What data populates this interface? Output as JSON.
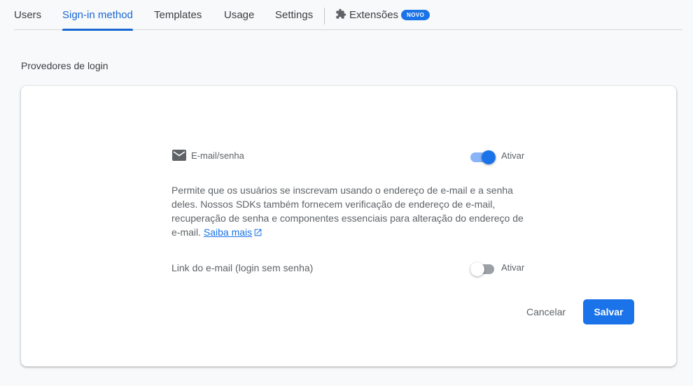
{
  "tabs": [
    {
      "label": "Users"
    },
    {
      "label": "Sign-in method",
      "active": true
    },
    {
      "label": "Templates"
    },
    {
      "label": "Usage"
    },
    {
      "label": "Settings"
    },
    {
      "label": "Extensões",
      "icon": "extension-icon",
      "badge": "NOVO"
    }
  ],
  "section": {
    "title": "Provedores de login"
  },
  "provider": {
    "icon": "mail-icon",
    "name": "E-mail/senha",
    "toggle_label": "Ativar",
    "enabled": true,
    "description": "Permite que os usuários se inscrevam usando o endereço de e-mail e a senha deles. Nossos SDKs também fornecem verificação de endereço de e-mail, recuperação de senha e componentes essenciais para alteração do endereço de e-mail. ",
    "learn_more": "Saiba mais"
  },
  "email_link": {
    "label": "Link do e-mail (login sem senha)",
    "toggle_label": "Ativar",
    "enabled": false
  },
  "actions": {
    "cancel": "Cancelar",
    "save": "Salvar"
  },
  "colors": {
    "accent": "#1a73e8",
    "tab_active": "#1967d2"
  }
}
